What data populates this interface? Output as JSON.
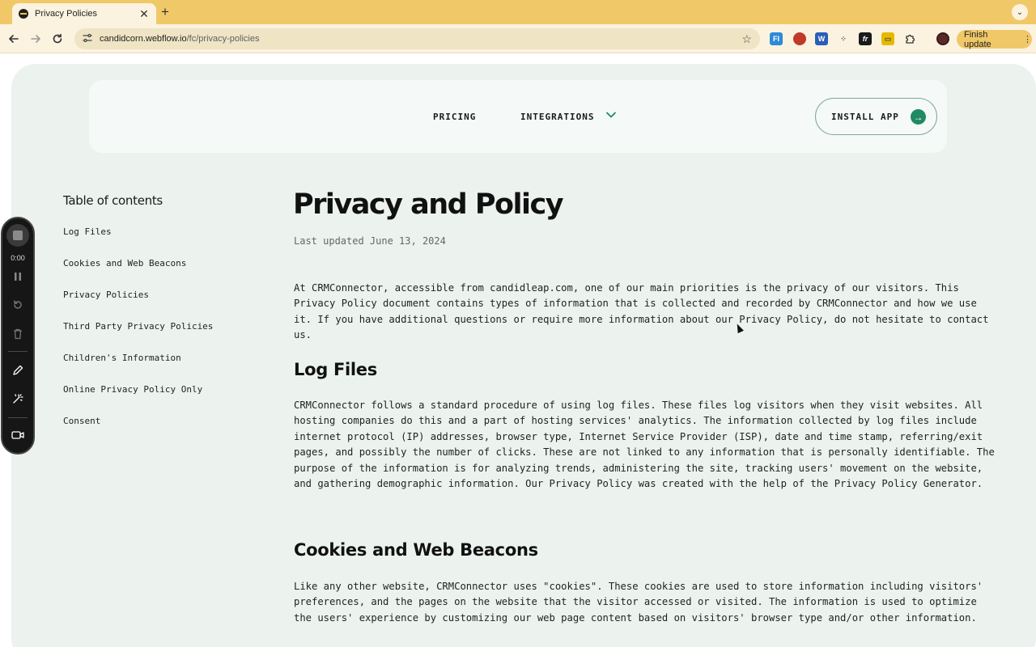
{
  "browser": {
    "tab_title": "Privacy Policies",
    "tab_close": "✕",
    "new_tab": "+",
    "tab_menu": "⌄",
    "url_host": "candidcorn.webflow.io",
    "url_path": "/fc/privacy-policies",
    "finish_update": "Finish update",
    "extensions": [
      "FI",
      "",
      "W",
      "",
      "fr",
      "",
      ""
    ]
  },
  "nav": {
    "pricing": "PRICING",
    "integrations": "INTEGRATIONS",
    "install_app": "INSTALL APP",
    "accent_color": "#1f8a63"
  },
  "toc": {
    "title": "Table of contents",
    "items": [
      "Log Files",
      "Cookies and Web Beacons",
      "Privacy Policies",
      "Third Party Privacy Policies",
      "Children's Information",
      "Online Privacy Policy Only",
      "Consent"
    ]
  },
  "article": {
    "title": "Privacy and Policy",
    "updated": "Last updated June 13, 2024",
    "intro": "At CRMConnector, accessible from candidleap.com, one of our main priorities is the privacy of our visitors. This Privacy Policy document contains types of information that is collected and recorded by CRMConnector and how we use it. If you have additional questions or require more information about our Privacy Policy, do not hesitate to contact us.",
    "sections": [
      {
        "heading": "Log Files",
        "body": "CRMConnector follows a standard procedure of using log files. These files log visitors when they visit websites. All hosting companies do this and a part of hosting services' analytics. The information collected by log files include internet protocol (IP) addresses, browser type, Internet Service Provider (ISP), date and time stamp, referring/exit pages, and possibly the number of clicks. These are not linked to any information that is personally identifiable. The purpose of the information is for analyzing trends, administering the site, tracking users' movement on the website, and gathering demographic information. Our Privacy Policy was created with the help of the Privacy Policy Generator."
      },
      {
        "heading": "Cookies and Web Beacons",
        "body": "Like any other website, CRMConnector uses \"cookies\". These cookies are used to store information including visitors' preferences, and the pages on the website that the visitor accessed or visited. The information is used to optimize the users' experience by customizing our web page content based on visitors' browser type and/or other information."
      }
    ]
  },
  "recorder": {
    "time": "0:00"
  }
}
